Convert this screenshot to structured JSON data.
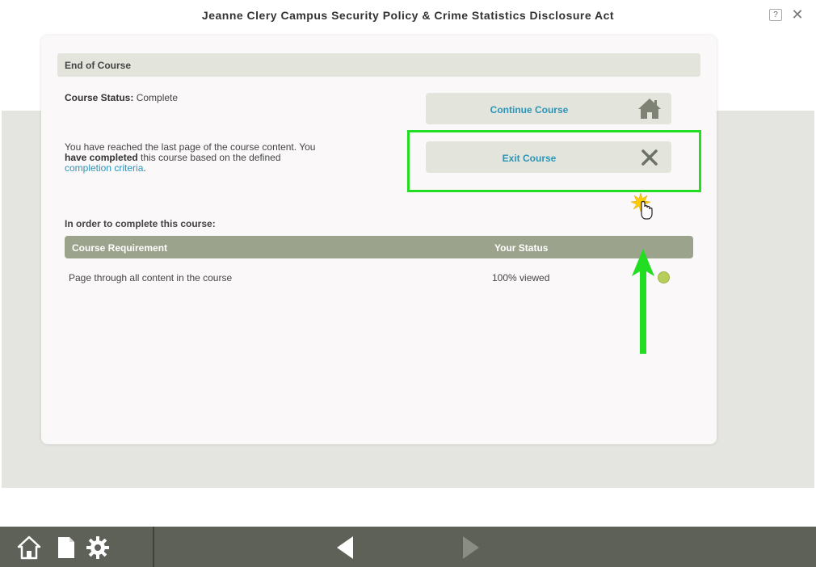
{
  "window": {
    "title": "Jeanne Clery Campus Security Policy & Crime Statistics Disclosure Act",
    "help_label": "?",
    "close_icon": "close-icon"
  },
  "panel": {
    "header": "End of Course",
    "status_label": "Course Status:",
    "status_value": "Complete",
    "message_part1": "You have reached the last page of the course content. You ",
    "message_bold": "have completed",
    "message_part2": " this course based on the defined ",
    "message_link": "completion criteria",
    "message_end": "."
  },
  "buttons": {
    "continue_label": "Continue Course",
    "continue_icon": "home-icon",
    "exit_label": "Exit Course",
    "exit_icon": "close-x-icon"
  },
  "requirements": {
    "heading": "In order to complete this course:",
    "columns": [
      "Course Requirement",
      "Your Status"
    ],
    "rows": [
      {
        "requirement": "Page through all content in the course",
        "status": "100% viewed",
        "indicator_color": "#b7cf5a"
      }
    ]
  },
  "colors": {
    "highlight": "#22dd22",
    "link": "#2b94b8",
    "bottom_bar": "#5e6158"
  },
  "bottom_bar": {
    "icons": [
      "home-icon",
      "page-icon",
      "gear-icon",
      "back-arrow-icon",
      "next-arrow-icon"
    ]
  }
}
